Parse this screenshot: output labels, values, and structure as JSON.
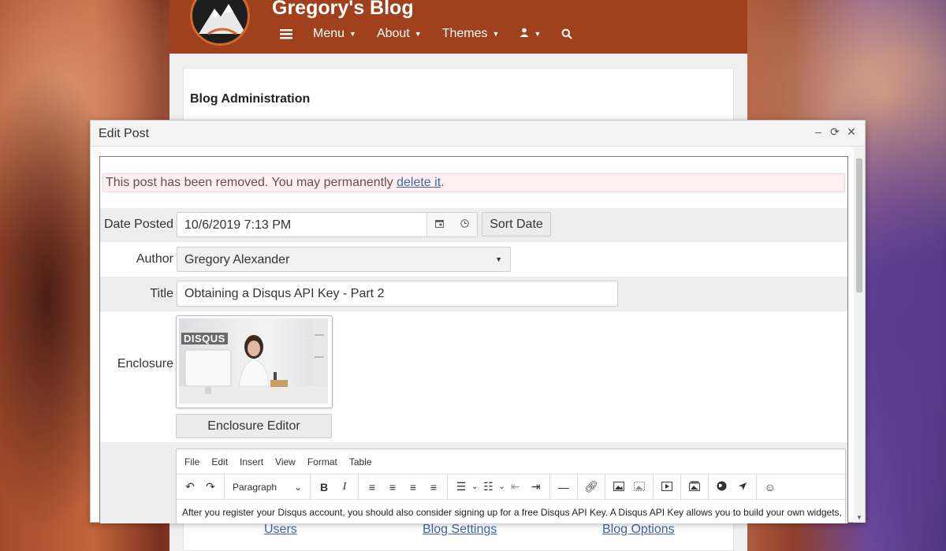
{
  "blog": {
    "title": "Gregory's Blog",
    "nav": [
      {
        "label": "Menu"
      },
      {
        "label": "About"
      },
      {
        "label": "Themes"
      }
    ],
    "admin_title": "Blog Administration",
    "admin_links": [
      "Users",
      "Blog Settings",
      "Blog Options"
    ]
  },
  "modal": {
    "title": "Edit Post",
    "alert_text": "This post has been removed. You may permanently ",
    "alert_link": "delete it",
    "alert_end": ".",
    "date_label": "Date Posted",
    "date_value": "10/6/2019 7:13 PM",
    "sort_date_label": "Sort Date",
    "author_label": "Author",
    "author_value": "Gregory Alexander",
    "title_label": "Title",
    "title_value": "Obtaining a Disqus API Key - Part 2",
    "enclosure_label": "Enclosure",
    "enclosure_logo_text": "DISQUS",
    "enclosure_editor_label": "Enclosure Editor"
  },
  "editor": {
    "menu": [
      "File",
      "Edit",
      "Insert",
      "View",
      "Format",
      "Table"
    ],
    "block_format": "Paragraph",
    "bold": "B",
    "italic": "I",
    "content": "After you register your Disqus account, you should also consider signing up for a free Disqus API Key. A Disqus API Key allows you to build your own widgets,"
  }
}
